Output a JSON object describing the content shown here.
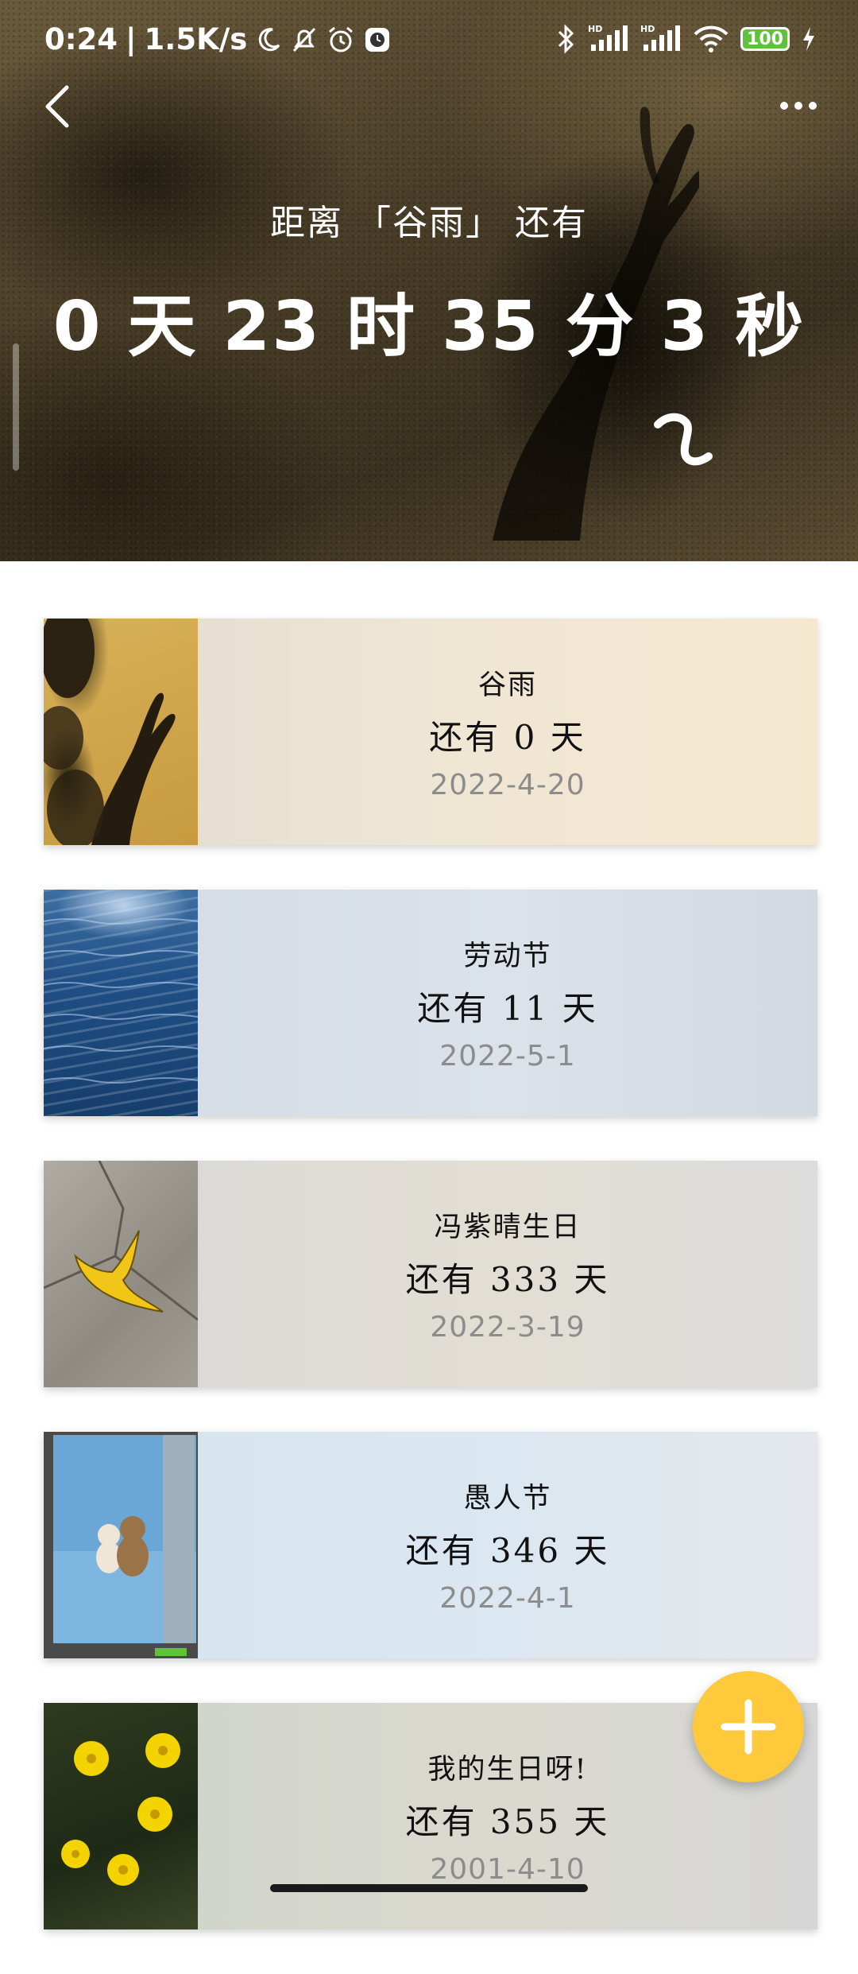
{
  "status_bar": {
    "time": "0:24",
    "network_speed": "1.5K/s",
    "battery_level": "100",
    "icons": [
      "moon-icon",
      "bell-off-icon",
      "alarm-icon",
      "app-icon",
      "bluetooth-icon",
      "signal-hd-icon",
      "signal-hd-icon",
      "wifi-icon",
      "battery-icon",
      "charging-icon"
    ]
  },
  "header": {
    "subtitle": "距离 「谷雨」 还有",
    "countdown": "0 天 23 时 35 分 3   秒",
    "back_icon": "chevron-left-icon",
    "more_icon": "more-dots-icon"
  },
  "events": [
    {
      "name": "谷雨",
      "remaining": "还有 0 天",
      "date": "2022-4-20"
    },
    {
      "name": "劳动节",
      "remaining": "还有 11 天",
      "date": "2022-5-1"
    },
    {
      "name": "冯紫晴生日",
      "remaining": "还有 333 天",
      "date": "2022-3-19"
    },
    {
      "name": "愚人节",
      "remaining": "还有 346 天",
      "date": "2022-4-1"
    },
    {
      "name": "我的生日呀!",
      "remaining": "还有 355 天",
      "date": "2001-4-10"
    }
  ],
  "fab": {
    "icon": "plus-icon",
    "color": "#ffc93c"
  }
}
